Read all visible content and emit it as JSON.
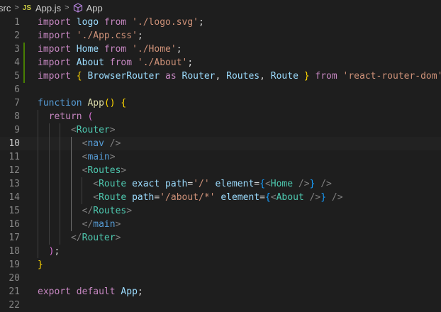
{
  "breadcrumb": {
    "folder": "src",
    "file_badge": "JS",
    "file": "App.js",
    "symbol": "App",
    "separator": ">"
  },
  "editor": {
    "current_line": 10,
    "modified_lines": [
      3,
      4,
      5
    ],
    "lines": [
      {
        "n": "1",
        "tokens": [
          [
            "import",
            "kw"
          ],
          [
            " "
          ],
          [
            "logo",
            "var"
          ],
          [
            " "
          ],
          [
            "from",
            "kw"
          ],
          [
            " "
          ],
          [
            "'./logo.svg'",
            "str"
          ],
          [
            ";",
            "pl"
          ]
        ]
      },
      {
        "n": "2",
        "tokens": [
          [
            "import",
            "kw"
          ],
          [
            " "
          ],
          [
            "'./App.css'",
            "str"
          ],
          [
            ";",
            "pl"
          ]
        ]
      },
      {
        "n": "3",
        "tokens": [
          [
            "import",
            "kw"
          ],
          [
            " "
          ],
          [
            "Home",
            "var"
          ],
          [
            " "
          ],
          [
            "from",
            "kw"
          ],
          [
            " "
          ],
          [
            "'./Home'",
            "str"
          ],
          [
            ";",
            "pl"
          ]
        ]
      },
      {
        "n": "4",
        "tokens": [
          [
            "import",
            "kw"
          ],
          [
            " "
          ],
          [
            "About",
            "var"
          ],
          [
            " "
          ],
          [
            "from",
            "kw"
          ],
          [
            " "
          ],
          [
            "'./About'",
            "str"
          ],
          [
            ";",
            "pl"
          ]
        ]
      },
      {
        "n": "5",
        "tokens": [
          [
            "import",
            "kw"
          ],
          [
            " "
          ],
          [
            "{",
            "b1"
          ],
          [
            " "
          ],
          [
            "BrowserRouter",
            "var"
          ],
          [
            " "
          ],
          [
            "as",
            "kw"
          ],
          [
            " "
          ],
          [
            "Router",
            "var"
          ],
          [
            ",",
            "pl"
          ],
          [
            " "
          ],
          [
            "Routes",
            "var"
          ],
          [
            ",",
            "pl"
          ],
          [
            " "
          ],
          [
            "Route",
            "var"
          ],
          [
            " "
          ],
          [
            "}",
            "b1"
          ],
          [
            " "
          ],
          [
            "from",
            "kw"
          ],
          [
            " "
          ],
          [
            "'react-router-dom'",
            "str"
          ]
        ]
      },
      {
        "n": "6",
        "tokens": []
      },
      {
        "n": "7",
        "tokens": [
          [
            "function",
            "bl"
          ],
          [
            " "
          ],
          [
            "App",
            "fn"
          ],
          [
            "()",
            "b1"
          ],
          [
            " "
          ],
          [
            "{",
            "b1"
          ]
        ]
      },
      {
        "n": "8",
        "tokens": [
          [
            "  "
          ],
          [
            "return",
            "kw"
          ],
          [
            " "
          ],
          [
            "(",
            "b2"
          ]
        ]
      },
      {
        "n": "9",
        "tokens": [
          [
            "      "
          ],
          [
            "<",
            "pt"
          ],
          [
            "Router",
            "tag"
          ],
          [
            ">",
            "pt"
          ]
        ]
      },
      {
        "n": "10",
        "tokens": [
          [
            "        "
          ],
          [
            "<",
            "pt"
          ],
          [
            "nav",
            "bl"
          ],
          [
            " "
          ],
          [
            "/>",
            "pt"
          ]
        ]
      },
      {
        "n": "11",
        "tokens": [
          [
            "        "
          ],
          [
            "<",
            "pt"
          ],
          [
            "main",
            "bl"
          ],
          [
            ">",
            "pt"
          ]
        ]
      },
      {
        "n": "12",
        "tokens": [
          [
            "        "
          ],
          [
            "<",
            "pt"
          ],
          [
            "Routes",
            "tag"
          ],
          [
            ">",
            "pt"
          ]
        ]
      },
      {
        "n": "13",
        "tokens": [
          [
            "          "
          ],
          [
            "<",
            "pt"
          ],
          [
            "Route",
            "tag"
          ],
          [
            " "
          ],
          [
            "exact",
            "at"
          ],
          [
            " "
          ],
          [
            "path",
            "at"
          ],
          [
            "=",
            "pl"
          ],
          [
            "'/'",
            "str"
          ],
          [
            " "
          ],
          [
            "element",
            "at"
          ],
          [
            "=",
            "pl"
          ],
          [
            "{",
            "b3"
          ],
          [
            "<",
            "pt"
          ],
          [
            "Home",
            "tag"
          ],
          [
            " "
          ],
          [
            "/>",
            "pt"
          ],
          [
            "}",
            "b3"
          ],
          [
            " "
          ],
          [
            "/>",
            "pt"
          ]
        ]
      },
      {
        "n": "14",
        "tokens": [
          [
            "          "
          ],
          [
            "<",
            "pt"
          ],
          [
            "Route",
            "tag"
          ],
          [
            " "
          ],
          [
            "path",
            "at"
          ],
          [
            "=",
            "pl"
          ],
          [
            "'/about/*'",
            "str"
          ],
          [
            " "
          ],
          [
            "element",
            "at"
          ],
          [
            "=",
            "pl"
          ],
          [
            "{",
            "b3"
          ],
          [
            "<",
            "pt"
          ],
          [
            "About",
            "tag"
          ],
          [
            " "
          ],
          [
            "/>",
            "pt"
          ],
          [
            "}",
            "b3"
          ],
          [
            " "
          ],
          [
            "/>",
            "pt"
          ]
        ]
      },
      {
        "n": "15",
        "tokens": [
          [
            "        "
          ],
          [
            "</",
            "pt"
          ],
          [
            "Routes",
            "tag"
          ],
          [
            ">",
            "pt"
          ]
        ]
      },
      {
        "n": "16",
        "tokens": [
          [
            "        "
          ],
          [
            "</",
            "pt"
          ],
          [
            "main",
            "bl"
          ],
          [
            ">",
            "pt"
          ]
        ]
      },
      {
        "n": "17",
        "tokens": [
          [
            "      "
          ],
          [
            "</",
            "pt"
          ],
          [
            "Router",
            "tag"
          ],
          [
            ">",
            "pt"
          ]
        ]
      },
      {
        "n": "18",
        "tokens": [
          [
            "  "
          ],
          [
            ")",
            "b2"
          ],
          [
            ";",
            "pl"
          ]
        ]
      },
      {
        "n": "19",
        "tokens": [
          [
            "}",
            "b1"
          ]
        ]
      },
      {
        "n": "20",
        "tokens": []
      },
      {
        "n": "21",
        "tokens": [
          [
            "export",
            "kw"
          ],
          [
            " "
          ],
          [
            "default",
            "kw"
          ],
          [
            " "
          ],
          [
            "App",
            "var"
          ],
          [
            ";",
            "pl"
          ]
        ]
      },
      {
        "n": "22",
        "tokens": []
      }
    ]
  }
}
